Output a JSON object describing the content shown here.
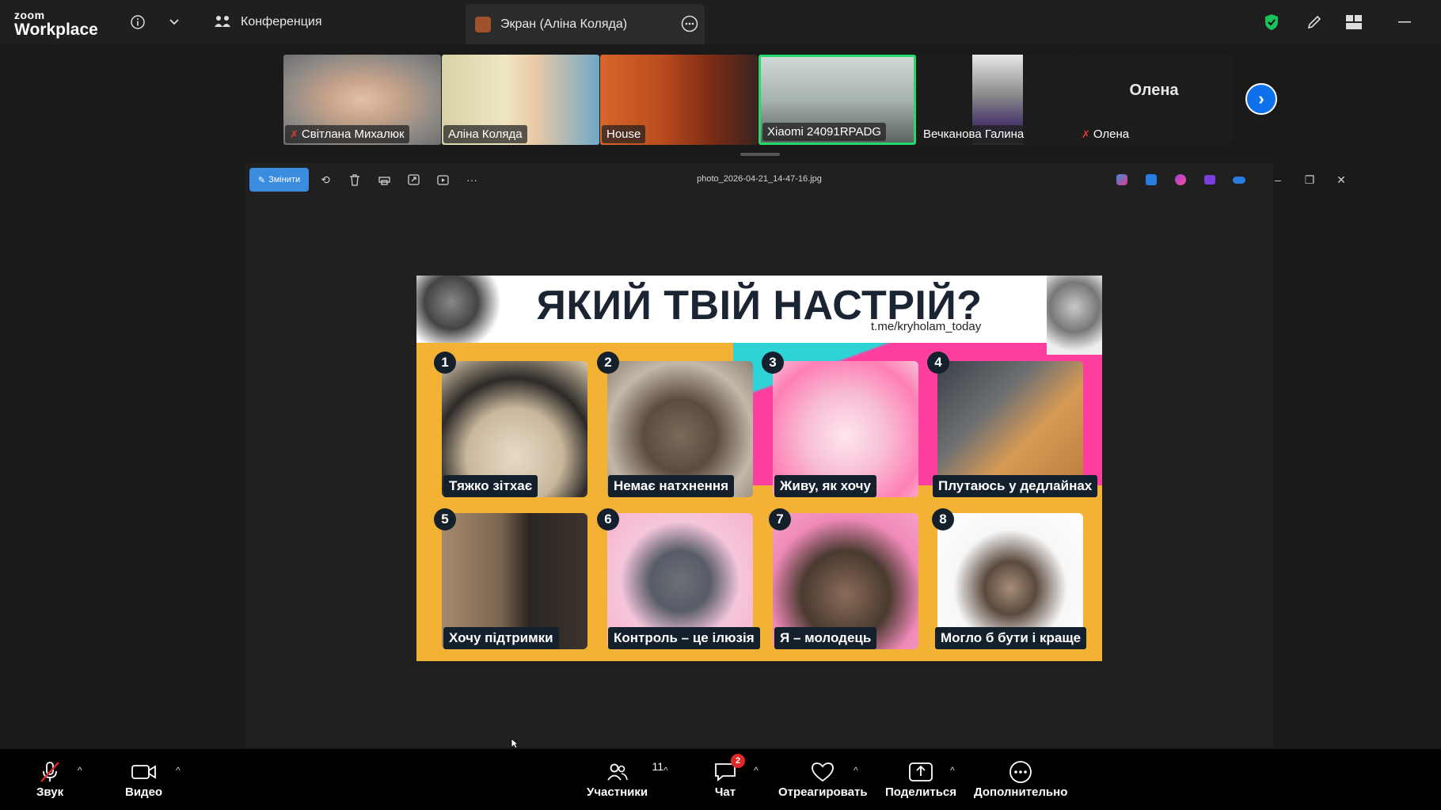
{
  "app": {
    "logo_top": "zoom",
    "logo_bottom": "Workplace"
  },
  "topbar": {
    "conference_label": "Конференция",
    "screen_tab_label": "Экран (Аліна Коляда)"
  },
  "participants": [
    {
      "name": "Світлана Михалюк",
      "muted": true
    },
    {
      "name": "Аліна Коляда",
      "muted": false
    },
    {
      "name": "House",
      "muted": false
    },
    {
      "name": "Xiaomi 24091RPADG",
      "muted": false
    },
    {
      "name": "Вечканова Галина",
      "muted": false
    },
    {
      "name": "Олена",
      "muted": true,
      "avatar_text": "Олена"
    }
  ],
  "viewer": {
    "edit_label": "Змінити",
    "filename": "photo_2026-04-21_14-47-16.jpg"
  },
  "meme": {
    "title": "ЯКИЙ ТВІЙ НАСТРІЙ?",
    "source": "t.me/kryholam_today",
    "cards": [
      {
        "num": "1",
        "caption": "Тяжко зітхає"
      },
      {
        "num": "2",
        "caption": "Немає натхнення"
      },
      {
        "num": "3",
        "caption": "Живу, як хочу"
      },
      {
        "num": "4",
        "caption": "Плутаюсь у дедлайнах"
      },
      {
        "num": "5",
        "caption": "Хочу підтримки"
      },
      {
        "num": "6",
        "caption": "Контроль – це ілюзія"
      },
      {
        "num": "7",
        "caption": "Я – молодець"
      },
      {
        "num": "8",
        "caption": "Могло б бути і краще"
      }
    ]
  },
  "bottombar": {
    "audio_label": "Звук",
    "video_label": "Видео",
    "participants_label": "Участники",
    "participants_count": "11",
    "chat_label": "Чат",
    "chat_badge": "2",
    "react_label": "Отреагировать",
    "share_label": "Поделиться",
    "more_label": "Дополнительно"
  },
  "colors": {
    "accent": "#0e71eb",
    "active_speaker": "#23d96a",
    "muted": "#e23a3a",
    "shield": "#19c25a"
  }
}
